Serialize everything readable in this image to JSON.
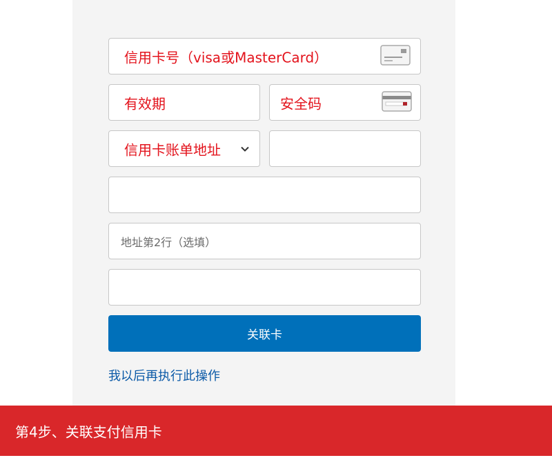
{
  "form": {
    "card_number_label": "信用卡号（visa或MasterCard）",
    "expiry_label": "有效期",
    "security_code_label": "安全码",
    "billing_address_label": "信用卡账单地址",
    "address_line2_placeholder": "地址第2行（选填）",
    "submit_label": "关联卡",
    "later_link": "我以后再执行此操作"
  },
  "banner": {
    "text": "第4步、关联支付信用卡"
  },
  "colors": {
    "label_red": "#e3131c",
    "button_blue": "#0070ba",
    "link_blue": "#0b5aa7",
    "banner_red": "#d9272a"
  },
  "icons": {
    "card_number": "credit-card-front-icon",
    "security_code": "credit-card-back-icon",
    "billing_address": "chevron-down-icon"
  }
}
